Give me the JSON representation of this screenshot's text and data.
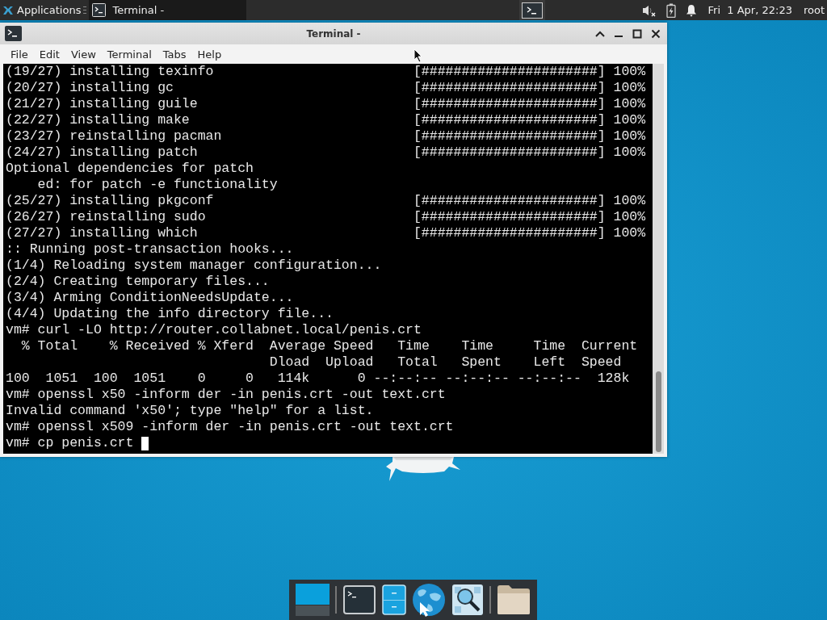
{
  "top_panel": {
    "applications_menu": "Applications",
    "tasks": [
      {
        "title": "Terminal -",
        "selected": true
      }
    ],
    "clock": "Fri  1 Apr, 22:23",
    "user": "root"
  },
  "window": {
    "title": "Terminal -",
    "menu": [
      "File",
      "Edit",
      "View",
      "Terminal",
      "Tabs",
      "Help"
    ],
    "lines": [
      {
        "text": "(19/27) installing texinfo",
        "progress": "[######################] 100%"
      },
      {
        "text": "(20/27) installing gc",
        "progress": "[######################] 100%"
      },
      {
        "text": "(21/27) installing guile",
        "progress": "[######################] 100%"
      },
      {
        "text": "(22/27) installing make",
        "progress": "[######################] 100%"
      },
      {
        "text": "(23/27) reinstalling pacman",
        "progress": "[######################] 100%"
      },
      {
        "text": "(24/27) installing patch",
        "progress": "[######################] 100%"
      },
      {
        "text": "Optional dependencies for patch"
      },
      {
        "text": "    ed: for patch -e functionality"
      },
      {
        "text": "(25/27) installing pkgconf",
        "progress": "[######################] 100%"
      },
      {
        "text": "(26/27) reinstalling sudo",
        "progress": "[######################] 100%"
      },
      {
        "text": "(27/27) installing which",
        "progress": "[######################] 100%"
      },
      {
        "text": ":: Running post-transaction hooks..."
      },
      {
        "text": "(1/4) Reloading system manager configuration..."
      },
      {
        "text": "(2/4) Creating temporary files..."
      },
      {
        "text": "(3/4) Arming ConditionNeedsUpdate..."
      },
      {
        "text": "(4/4) Updating the info directory file..."
      },
      {
        "text": "vm# curl -LO http://router.collabnet.local/penis.crt"
      },
      {
        "text": "  % Total    % Received % Xferd  Average Speed   Time    Time     Time  Current"
      },
      {
        "text": "                                 Dload  Upload   Total   Spent    Left  Speed"
      },
      {
        "text": "100  1051  100  1051    0     0   114k      0 --:--:-- --:--:-- --:--:--  128k"
      },
      {
        "text": "vm# openssl x50 -inform der -in penis.crt -out text.crt"
      },
      {
        "text": "Invalid command 'x50'; type \"help\" for a list."
      },
      {
        "text": "vm# openssl x509 -inform der -in penis.crt -out text.crt"
      },
      {
        "text": "vm# cp penis.crt ",
        "cursor": true
      }
    ]
  },
  "dock": [
    {
      "kind": "workspaces"
    },
    {
      "kind": "separator"
    },
    {
      "kind": "terminal"
    },
    {
      "kind": "files"
    },
    {
      "kind": "browser"
    },
    {
      "kind": "appfinder"
    },
    {
      "kind": "separator"
    },
    {
      "kind": "folder"
    }
  ]
}
